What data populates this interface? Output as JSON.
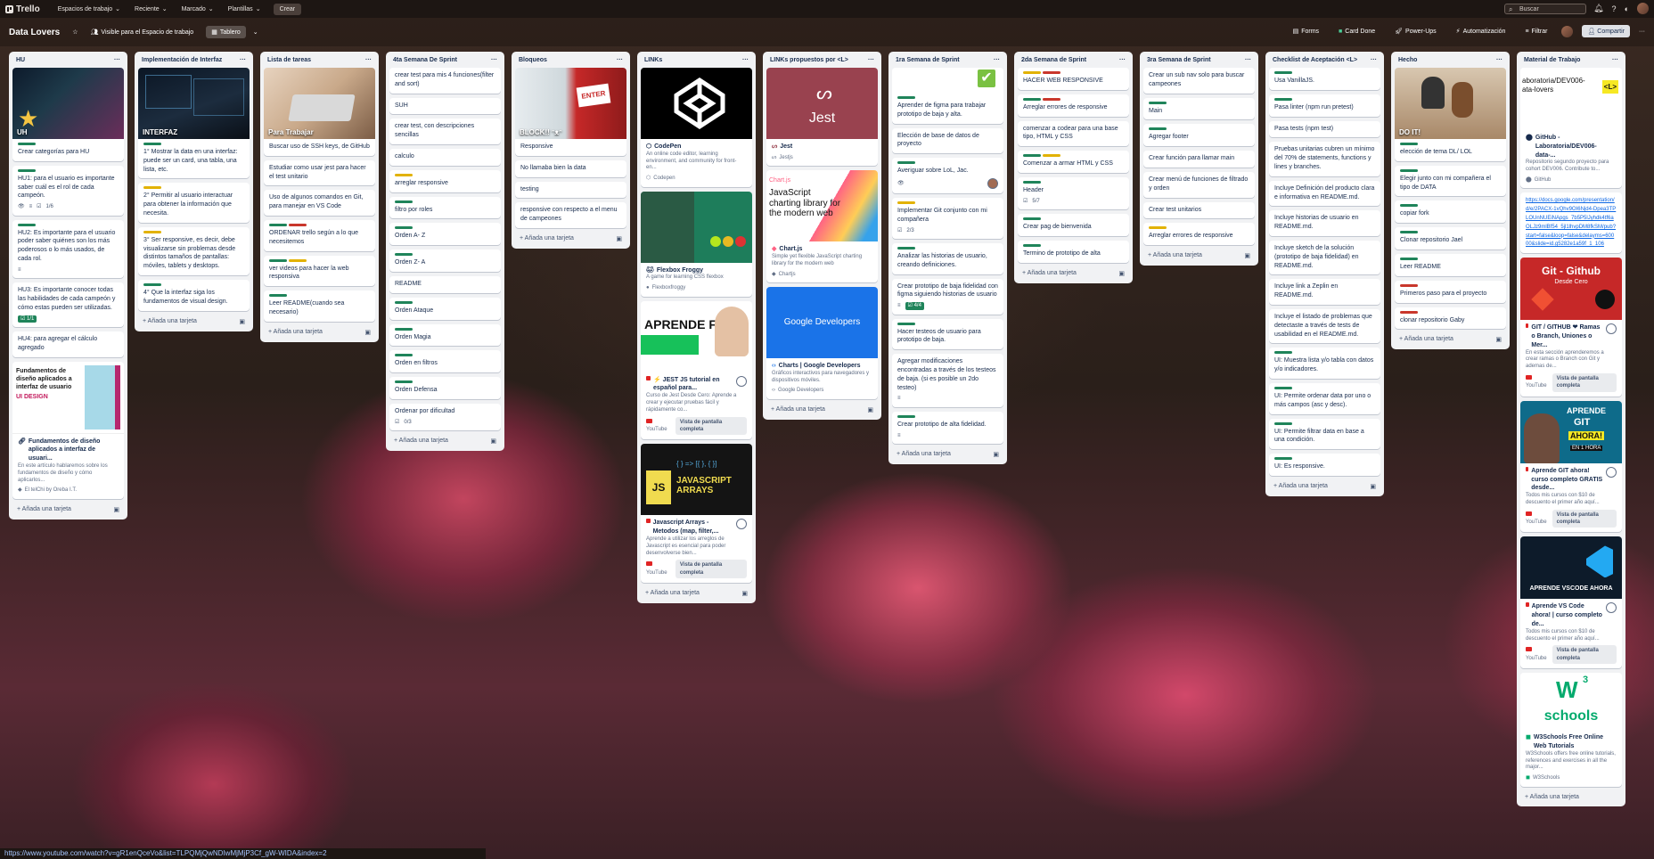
{
  "topbar": {
    "app": "Trello",
    "nav": [
      "Espacios de trabajo",
      "Reciente",
      "Marcado",
      "Plantillas"
    ],
    "create": "Crear",
    "search_placeholder": "Buscar"
  },
  "board": {
    "title": "Data Lovers",
    "visibility": "Visible para el Espacio de trabajo",
    "view": "Tablero",
    "right": [
      "Forms",
      "Card Done",
      "Power-Ups",
      "Automatización",
      "Filtrar",
      "Compartir"
    ]
  },
  "add_card": "Añada una tarjeta",
  "lists": {
    "hu": {
      "title": "HU",
      "cover": "UH",
      "cards": [
        "Crear categorías para HU",
        "HU1: para el usuario es importante saber cuál es el rol de cada campeón.",
        "HU2: Es importante para el usuario poder saber quiénes son los más poderosos o lo más usados, de cada rol.",
        "HU3: Es importante conocer todas las habilidades de cada campeón y cómo estas pueden ser utilizadas.",
        "HU4: para agregar el cálculo agregado"
      ],
      "checklist": "1/6",
      "checklist2": "1/1",
      "link": {
        "title": "Fundamentos de diseño aplicados a interfaz de usuari...",
        "desc": "En este artículo hablaremos sobre los fundamentos de diseño y cómo aplicarlos...",
        "source": "El telChi by Oreba I.T.",
        "cover_text": "Fundamentos de diseño aplicados a interfaz de usuario",
        "cover_tag": "UI DESIGN"
      }
    },
    "impl": {
      "title": "Implementación de Interfaz",
      "cover": "INTERFAZ",
      "cards": [
        "1°  Mostrar la data en una interfaz: puede ser un card, una tabla, una lista, etc.",
        "2° Permitir al usuario interactuar para obtener la información que necesita.",
        "3° Ser responsive, es decir, debe visualizarse sin problemas desde distintos tamaños de pantallas: móviles, tablets y desktops.",
        "4° Que la interfaz siga los fundamentos de visual design."
      ]
    },
    "tareas": {
      "title": "Lista de tareas",
      "cover": "Para Trabajar",
      "cards": [
        "Buscar uso de SSH keys, de GitHub",
        "Estudiar como usar jest para hacer el test unitario",
        "Uso de algunos comandos en Git, para manejar en VS Code",
        "ORDENAR trello según a lo que necesitemos",
        "ver videos para hacer la web responsiva",
        "Leer README(cuando sea necesario)"
      ]
    },
    "sprint4": {
      "title": "4ta Semana De Sprint",
      "cards": [
        "crear test para mis 4 funciones(filter and sort)",
        "SUH",
        "crear test, con descripciones sencillas",
        "calculo",
        "arreglar responsive",
        "filtro por roles",
        "Orden A- Z",
        "Orden Z- A",
        "README",
        "Orden Ataque",
        "Orden Magia",
        "Orden en filtros",
        "Orden Defensa",
        "Ordenar por dificultad"
      ],
      "count": "0/3"
    },
    "bloqueos": {
      "title": "Bloqueos",
      "cover": "BLOCK!! ᵔᴥᵔ",
      "cards": [
        "Responsive",
        "No llamaba bien la data",
        "testing",
        "responsive con respecto a el menu de campeones"
      ]
    },
    "links": {
      "title": "LINKs",
      "items": [
        {
          "title": "CodePen",
          "desc": "An online code editor, learning environment, and community for front-en...",
          "source": "Codepen"
        },
        {
          "title": "Flexbox Froggy",
          "desc": "A game for learning CSS flexbox",
          "source": "Flexboxfroggy"
        },
        {
          "title": "⚡ JEST JS tutorial en español para...",
          "desc": "Curso de Jest Desde Cero: Aprende a crear y ejecutar pruebas fácil y rápidamente co...",
          "source": "YouTube",
          "cover": "APRENDE FÁCIL"
        },
        {
          "title": "Javascript Arrays - Metodos (map, filter,...",
          "desc": "Aprende a utilizar los arreglos de Javascript es esencial para poder desenvolverse bien...",
          "source": "YouTube",
          "cover1": "JS",
          "cover2": "JAVASCRIPT ARRAYS",
          "cover3": "{ } => [{ }, { }]"
        }
      ],
      "embed": "Vista de pantalla completa"
    },
    "propuestos": {
      "title": "LINKs propuestos por <L>",
      "items": [
        {
          "title": "Jest",
          "source": "Jestjs",
          "cover": "Jest"
        },
        {
          "title": "Chart.js",
          "desc": "Simple yet flexible JavaScript charting library for the modern web",
          "source": "Chartjs",
          "cover": "JavaScript charting library for the modern web",
          "cover_tag": "Chart.js"
        },
        {
          "title": "Charts  |  Google Developers",
          "desc": "Gráficos interactivos para navegadores y dispositivos móviles.",
          "source": "Google Developers",
          "cover": "Google Developers"
        }
      ]
    },
    "sprint1": {
      "title": "1ra Semana de Sprint",
      "cards": [
        "Aprender de figma para trabajar prototipo de baja y alta.",
        "Elección de base de datos de proyecto",
        "Averiguar sobre LoL, Jac.",
        "Implementar Git conjunto con mi compañera",
        "Analizar las historias de usuario, creando definiciones.",
        "Crear prototipo de baja fidelidad con figma siguiendo historias de usuario",
        "Hacer testeos de usuario para prototipo de baja.",
        "Agregar modificaciones encontradas a través de los testeos de baja. (si es posible un 2do testeo)",
        "Crear prototipo de alta fidelidad."
      ],
      "c1": "2/3",
      "c2": "4/4"
    },
    "sprint2": {
      "title": "2da Semana de Sprint",
      "cards": [
        "HACER WEB RESPONSIVE",
        "Arreglar errores de responsive",
        "comenzar a codear para una base tipo, HTML y CSS",
        "Comenzar a armar HTML y CSS",
        "Header",
        "Crear pag de bienvenida",
        "Termino de prototipo de alta"
      ],
      "c1": "5/7"
    },
    "sprint3": {
      "title": "3ra Semana de Sprint",
      "cards": [
        "Crear un sub nav solo para buscar campeones",
        "Main",
        "Agregar footer",
        "Crear función para llamar main",
        "Crear menú de funciones de filtrado y orden",
        "Crear test unitarios",
        "Arreglar errores de responsive"
      ]
    },
    "checklist": {
      "title": "Checklist de Aceptación <L>",
      "cards": [
        "Usa VanillaJS.",
        "Pasa linter (npm run pretest)",
        "Pasa tests (npm test)",
        "Pruebas unitarias cubren un mínimo del 70% de statements, functions y lines y branches.",
        "Incluye Definición del producto clara e informativa en README.md.",
        "Incluye historias de usuario en README.md.",
        "Incluye sketch de la solución (prototipo de baja fidelidad) en README.md.",
        "Incluye link a Zeplin en README.md.",
        "Incluye el listado de problemas que detectaste a través de tests de usabilidad en el README.md.",
        "UI: Muestra lista y/o tabla con datos y/o indicadores.",
        "UI: Permite ordenar data por uno o más campos (asc y desc).",
        "UI: Permite filtrar data en base a una condición.",
        "UI: Es responsive."
      ]
    },
    "hecho": {
      "title": "Hecho",
      "cover": "DO IT!",
      "cards": [
        "elección de tema DL/ LOL",
        "Elegir junto con mi compañera el tipo de DATA",
        "copiar fork",
        "Clonar repositorio Jael",
        "Leer README",
        "Primeros paso para el proyecto",
        "clonar repositorio Gaby"
      ]
    },
    "material": {
      "title": "Material de Trabajo",
      "items": [
        {
          "title": "GitHub - Laboratoria/DEV006-data-...",
          "desc": "Repositorio segundo proyecto para cohort DEV006. Contribute to...",
          "source": "GitHub",
          "cover": "aboratoria/DEV006-ata-lovers",
          "cover_tag": "<L>"
        },
        {
          "url": "https://docs.google.com/presentation/d/e/2PACX-1vQhv9OI6Njd4-Dpea3TPLOUnNUEiNApgs_7b5P5lJyhdk4tf6aOLJz9mlBf54_5jl1lhvpDM8fkSM/pub?start=false&loop=false&delayms=60000&slide=id.g5282e1a59f_1_106"
        },
        {
          "title": "GIT / GITHUB ❤ Ramas o Branch, Uniones o Mer...",
          "desc": "En esta sección aprenderemos a crear ramas o Branch con Git y ademas de...",
          "source": "YouTube",
          "cover": "Git - Github",
          "cover_sub": "Desde Cero"
        },
        {
          "title": "Aprende GIT ahora! curso completo GRATIS desde...",
          "desc": "Todos mis cursos con $10 de descuento el primer año aquí...",
          "source": "YouTube",
          "cover1": "APRENDE",
          "cover2": "GIT",
          "cover3": "AHORA!",
          "cover4": "EN 1 HORA"
        },
        {
          "title": "Aprende VS Code ahora! | curso completo de...",
          "desc": "Todos mis cursos con $10 de descuento el primer año aquí...",
          "source": "YouTube",
          "cover": "APRENDE VSCODE AHORA"
        },
        {
          "title": "W3Schools Free Online Web Tutorials",
          "desc": "W3Schools offers free online tutorials, references and exercises in all the major...",
          "source": "W3Schools",
          "cover1": "W",
          "cover2": "3",
          "cover3": "schools"
        }
      ],
      "embed": "Vista de pantalla completa"
    }
  },
  "status_url": "https://www.youtube.com/watch?v=gR1enQceVo&list=TLPQMjQwNDIwMjMjP3Cf_gW-WIDA&index=2",
  "colors": {
    "green": "#1f845a",
    "yellow": "#e2b203",
    "red": "#c9372c",
    "list_bg": "#f1f2f4",
    "link": "#0c66e4"
  }
}
